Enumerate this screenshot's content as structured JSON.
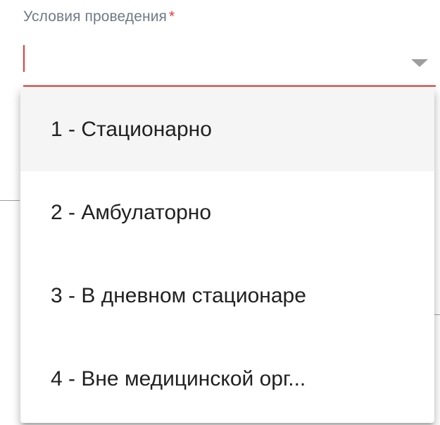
{
  "field": {
    "label": "Условия проведения",
    "required_mark": "*",
    "value": ""
  },
  "menu": {
    "items": [
      {
        "label": "1 - Стационарно",
        "highlighted": true
      },
      {
        "label": "2 - Амбулаторно",
        "highlighted": false
      },
      {
        "label": "3 - В дневном стационаре",
        "highlighted": false
      },
      {
        "label": "4 - Вне медицинской орг...",
        "highlighted": false
      }
    ]
  },
  "icons": {
    "dropdown": "chevron-down-icon"
  },
  "colors": {
    "error": "#e53935",
    "label": "#6f7a86",
    "text": "#212121",
    "highlight": "#f5f5f5"
  }
}
